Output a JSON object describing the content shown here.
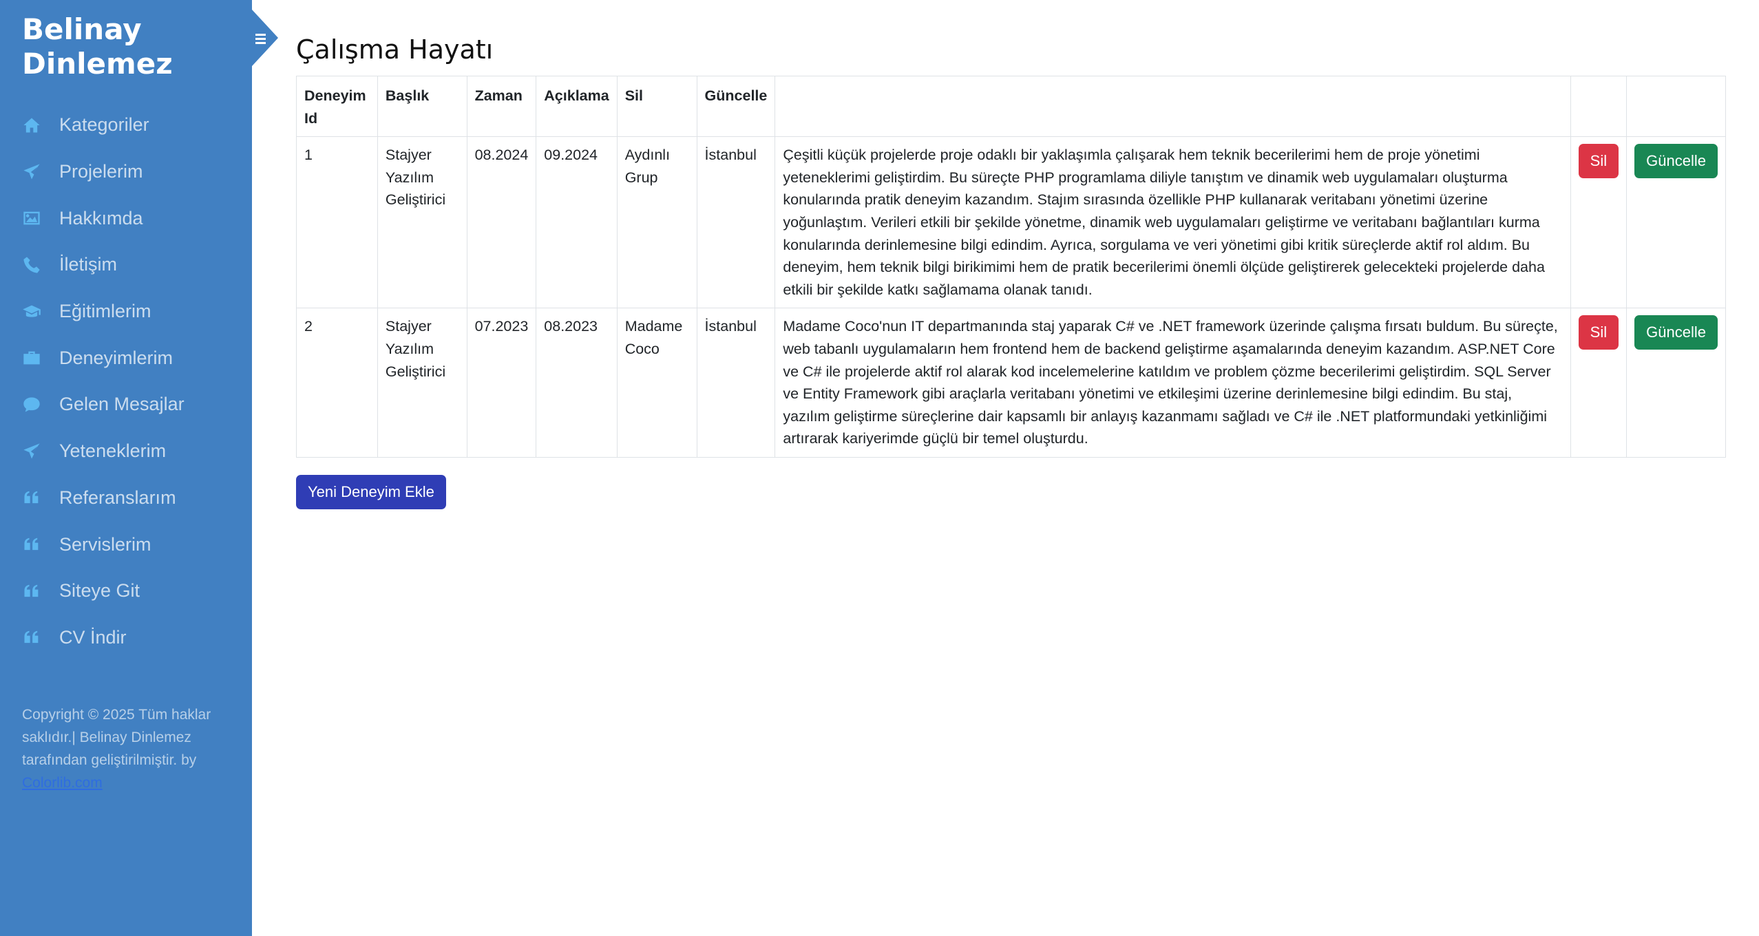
{
  "brand": {
    "line1": "Belinay",
    "line2": "Dinlemez"
  },
  "nav": [
    {
      "label": "Kategoriler",
      "icon": "home-icon"
    },
    {
      "label": "Projelerim",
      "icon": "paper-plane-icon"
    },
    {
      "label": "Hakkımda",
      "icon": "image-icon"
    },
    {
      "label": "İletişim",
      "icon": "phone-icon"
    },
    {
      "label": "Eğitimlerim",
      "icon": "graduation-cap-icon"
    },
    {
      "label": "Deneyimlerim",
      "icon": "briefcase-icon"
    },
    {
      "label": "Gelen Mesajlar",
      "icon": "comment-icon"
    },
    {
      "label": "Yeteneklerim",
      "icon": "paper-plane-icon"
    },
    {
      "label": "Referanslarım",
      "icon": "quote-icon"
    },
    {
      "label": "Servislerim",
      "icon": "quote-icon"
    },
    {
      "label": "Siteye Git",
      "icon": "quote-icon"
    },
    {
      "label": "CV İndir",
      "icon": "quote-icon"
    }
  ],
  "footer": {
    "text": "Copyright © 2025 Tüm haklar saklıdır.| Belinay Dinlemez tarafından geliştirilmiştir. by ",
    "link": "Colorlib.com"
  },
  "page": {
    "title": "Çalışma Hayatı"
  },
  "table": {
    "headers": [
      "Deneyim Id",
      "Başlık",
      "Zaman",
      "Açıklama",
      "Sil",
      "Güncelle"
    ],
    "rows": [
      {
        "id": "1",
        "title": "Stajyer Yazılım Geliştirici",
        "start": "08.2024",
        "end": "09.2024",
        "company": "Aydınlı Grup",
        "city": "İstanbul",
        "description": "Çeşitli küçük projelerde proje odaklı bir yaklaşımla çalışarak hem teknik becerilerimi hem de proje yönetimi yeteneklerimi geliştirdim. Bu süreçte PHP programlama diliyle tanıştım ve dinamik web uygulamaları oluşturma konularında pratik deneyim kazandım. Stajım sırasında özellikle PHP kullanarak veritabanı yönetimi üzerine yoğunlaştım. Verileri etkili bir şekilde yönetme, dinamik web uygulamaları geliştirme ve veritabanı bağlantıları kurma konularında derinlemesine bilgi edindim. Ayrıca, sorgulama ve veri yönetimi gibi kritik süreçlerde aktif rol aldım. Bu deneyim, hem teknik bilgi birikimimi hem de pratik becerilerimi önemli ölçüde geliştirerek gelecekteki projelerde daha etkili bir şekilde katkı sağlamama olanak tanıdı.",
        "delete_label": "Sil",
        "update_label": "Güncelle"
      },
      {
        "id": "2",
        "title": "Stajyer Yazılım Geliştirici",
        "start": "07.2023",
        "end": "08.2023",
        "company": "Madame Coco",
        "city": "İstanbul",
        "description": "Madame Coco'nun IT departmanında staj yaparak C# ve .NET framework üzerinde çalışma fırsatı buldum. Bu süreçte, web tabanlı uygulamaların hem frontend hem de backend geliştirme aşamalarında deneyim kazandım. ASP.NET Core ve C# ile projelerde aktif rol alarak kod incelemelerine katıldım ve problem çözme becerilerimi geliştirdim. SQL Server ve Entity Framework gibi araçlarla veritabanı yönetimi ve etkileşimi üzerine derinlemesine bilgi edindim. Bu staj, yazılım geliştirme süreçlerine dair kapsamlı bir anlayış kazanmamı sağladı ve C# ile .NET platformundaki yetkinliğimi artırarak kariyerimde güçlü bir temel oluşturdu.",
        "delete_label": "Sil",
        "update_label": "Güncelle"
      }
    ]
  },
  "add_button": "Yeni Deneyim Ekle",
  "colors": {
    "sidebar": "#4180c2",
    "icon": "#5db7f0",
    "delete": "#dc3545",
    "update": "#198754",
    "add": "#2f3db5"
  }
}
